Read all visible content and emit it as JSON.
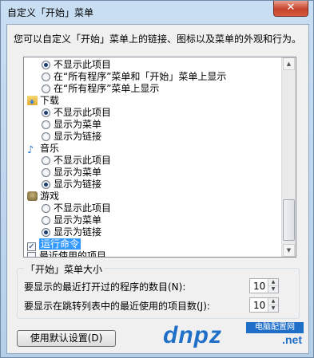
{
  "window": {
    "title": "自定义「开始」菜单",
    "close_glyph": "✕"
  },
  "description": "您可以自定义「开始」菜单上的链接、图标以及菜单的外观和行为。",
  "list": {
    "top_options": [
      {
        "label": "不显示此项目",
        "checked": true
      },
      {
        "label": "在“所有程序”菜单和「开始」菜单上显示",
        "checked": false
      },
      {
        "label": "在“所有程序”菜单上显示",
        "checked": false
      }
    ],
    "downloads": {
      "title": "下载",
      "icon": "folder-icon",
      "options": [
        {
          "label": "不显示此项目",
          "checked": true
        },
        {
          "label": "显示为菜单",
          "checked": false
        },
        {
          "label": "显示为链接",
          "checked": false
        }
      ]
    },
    "music": {
      "title": "音乐",
      "icon": "music-note-icon",
      "options": [
        {
          "label": "不显示此项目",
          "checked": false
        },
        {
          "label": "显示为菜单",
          "checked": false
        },
        {
          "label": "显示为链接",
          "checked": true
        }
      ]
    },
    "games": {
      "title": "游戏",
      "icon": "games-icon",
      "options": [
        {
          "label": "不显示此项目",
          "checked": false
        },
        {
          "label": "显示为菜单",
          "checked": false
        },
        {
          "label": "显示为链接",
          "checked": true
        }
      ]
    },
    "checkboxes": [
      {
        "label": "运行命令",
        "checked": true,
        "selected": true
      },
      {
        "label": "最近使用的项目",
        "checked": false,
        "selected": false
      }
    ]
  },
  "start_menu_size": {
    "legend": "「开始」菜单大小",
    "recent_programs_label": "要显示的最近打开过的程序的数目(N):",
    "recent_programs_value": "10",
    "jump_list_label": "要显示在跳转列表中的最近使用的项目数(J):",
    "jump_list_value": "10"
  },
  "default_button": "使用默认设置(D)",
  "watermark": {
    "main": "dnpz",
    "tag": "电脑配置网",
    "suffix": ".net"
  },
  "colors": {
    "selection": "#3399ff",
    "watermark": "#1f6fc9"
  }
}
